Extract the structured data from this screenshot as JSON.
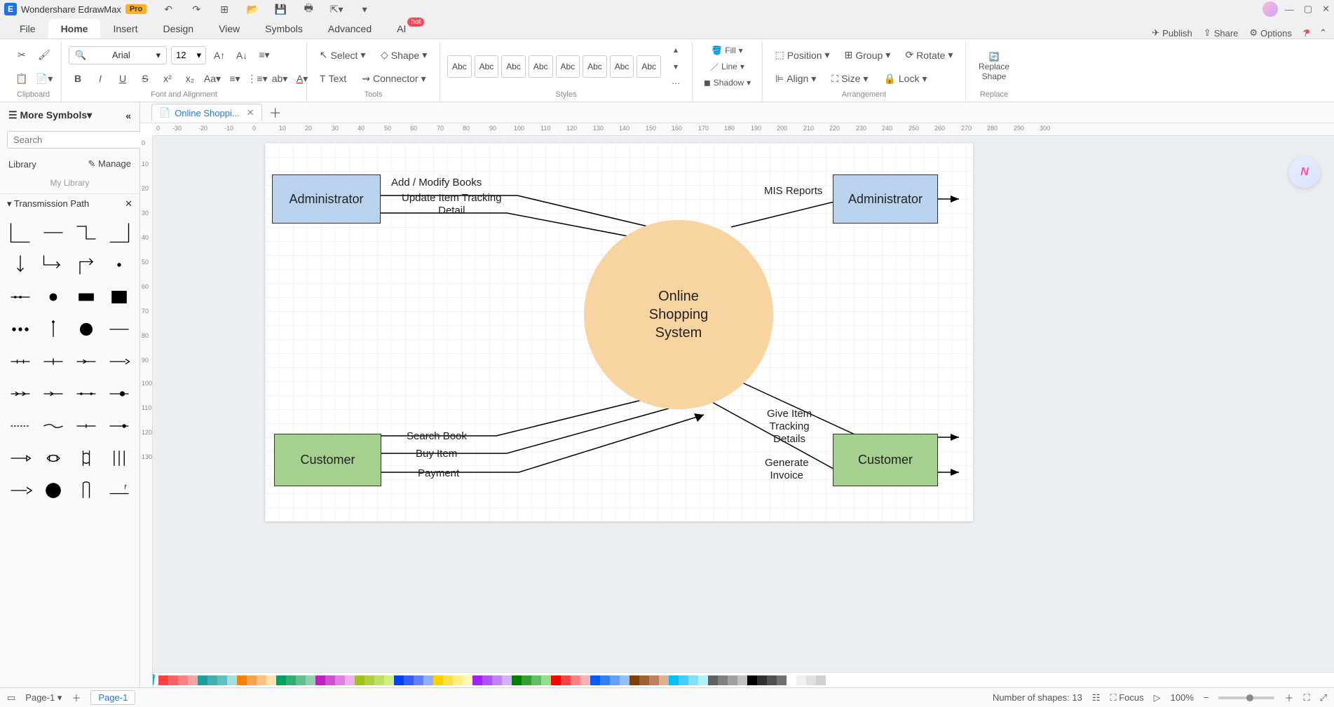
{
  "app": {
    "name": "Wondershare EdrawMax",
    "badge": "Pro"
  },
  "menu": {
    "file": "File",
    "home": "Home",
    "insert": "Insert",
    "design": "Design",
    "view": "View",
    "symbols": "Symbols",
    "advanced": "Advanced",
    "ai": "AI",
    "hot": "hot",
    "publish": "Publish",
    "share": "Share",
    "options": "Options"
  },
  "ribbon": {
    "clipboard": "Clipboard",
    "font_alignment": "Font and Alignment",
    "tools": "Tools",
    "styles": "Styles",
    "arrangement": "Arrangement",
    "replace": "Replace",
    "font_name": "Arial",
    "font_size": "12",
    "select": "Select",
    "text": "Text",
    "shape": "Shape",
    "connector": "Connector",
    "fill": "Fill",
    "line": "Line",
    "shadow": "Shadow",
    "position": "Position",
    "align": "Align",
    "group": "Group",
    "size": "Size",
    "rotate": "Rotate",
    "lock": "Lock",
    "replace_shape": "Replace\nShape",
    "style_text": "Abc"
  },
  "sidebar": {
    "more_symbols": "More Symbols",
    "search_placeholder": "Search",
    "search_btn": "Search",
    "library": "Library",
    "manage": "Manage",
    "my_library": "My Library",
    "section": "Transmission Path"
  },
  "tabs": {
    "doc": "Online Shoppi..."
  },
  "diagram": {
    "admin_left": "Administrator",
    "admin_right": "Administrator",
    "cust_left": "Customer",
    "cust_right": "Customer",
    "center_l1": "Online",
    "center_l2": "Shopping",
    "center_l3": "System",
    "add_modify": "Add / Modify Books",
    "update_detail": "Update Item Tracking\nDetail",
    "mis": "MIS Reports",
    "search_book": "Search Book",
    "buy_item": "Buy Item",
    "payment": "Payment",
    "give_item": "Give Item\nTracking\nDetails",
    "gen_invoice": "Generate\nInvoice"
  },
  "status": {
    "page_dropdown": "Page-1",
    "page_tab": "Page-1",
    "shapes": "Number of shapes: 13",
    "focus": "Focus",
    "zoom": "100%"
  },
  "palette": [
    "#ff4040",
    "#ff6060",
    "#ff8080",
    "#ffa0a0",
    "#1aa0a0",
    "#40b0b0",
    "#60c0c0",
    "#a0e0e0",
    "#ff8000",
    "#ffa040",
    "#ffc080",
    "#ffe0b0",
    "#00a060",
    "#30b070",
    "#60c090",
    "#90d0b0",
    "#c020c0",
    "#d050d0",
    "#e080e0",
    "#f0b0f0",
    "#a0c020",
    "#b0d040",
    "#c0e060",
    "#d0f080",
    "#0040ff",
    "#3060ff",
    "#6080ff",
    "#90b0ff",
    "#ffd000",
    "#ffe040",
    "#fff080",
    "#fff8b0",
    "#a020ff",
    "#b050ff",
    "#c080ff",
    "#d0b0ff",
    "#008000",
    "#30a030",
    "#60c060",
    "#90e090",
    "#ff0000",
    "#ff4040",
    "#ff8080",
    "#ffb0b0",
    "#0060ff",
    "#3080ff",
    "#60a0ff",
    "#90c0ff",
    "#804000",
    "#a06030",
    "#c08060",
    "#e0b090",
    "#00c0ff",
    "#40d0ff",
    "#80e0ff",
    "#b0f0ff",
    "#606060",
    "#808080",
    "#a0a0a0",
    "#c0c0c0",
    "#000000",
    "#303030",
    "#505050",
    "#707070",
    "#ffffff",
    "#f0f0f0",
    "#e0e0e0",
    "#d0d0d0"
  ]
}
